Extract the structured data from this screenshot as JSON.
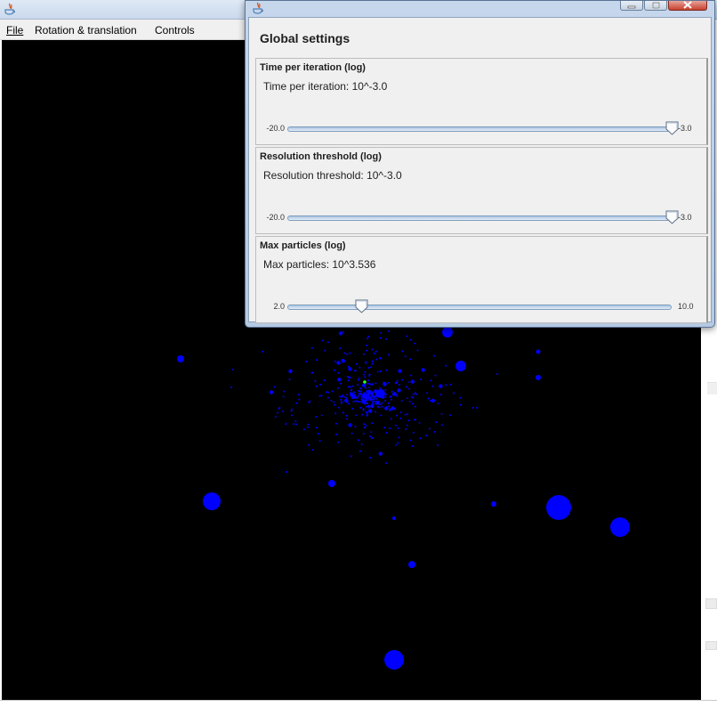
{
  "main_window": {
    "menu": [
      {
        "label": "File"
      },
      {
        "label": "Rotation & translation"
      },
      {
        "label": "Controls"
      }
    ],
    "canvas": {
      "background": "#000000",
      "particle_color": "#0000ff",
      "highlight_color": "#33ff33"
    }
  },
  "settings_dialog": {
    "heading": "Global settings",
    "panels": [
      {
        "title": "Time per iteration (log)",
        "value_text": "Time per iteration: 10^-3.0",
        "min_label": "-20.0",
        "max_label": "-3.0",
        "min": -20.0,
        "max": -3.0,
        "value": -3.0
      },
      {
        "title": "Resolution threshold (log)",
        "value_text": "Resolution threshold: 10^-3.0",
        "min_label": "-20.0",
        "max_label": "-3.0",
        "min": -20.0,
        "max": -3.0,
        "value": -3.0
      },
      {
        "title": "Max particles (log)",
        "value_text": "Max particles: 10^3.536",
        "min_label": "2.0",
        "max_label": "10.0",
        "min": 2.0,
        "max": 10.0,
        "value": 3.536
      }
    ]
  },
  "icons": {
    "app": "java-cup-icon",
    "minimize": "minimize-icon",
    "maximize": "maximize-icon",
    "close": "close-icon"
  }
}
